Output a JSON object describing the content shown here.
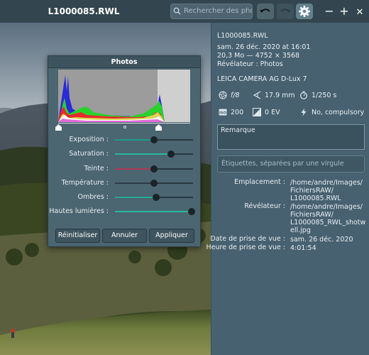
{
  "window": {
    "title": "L1000085.RWL",
    "search_placeholder": "Rechercher des pho…",
    "icons": [
      "search-icon",
      "rotate-left-icon",
      "rotate-right-icon",
      "gear-icon",
      "minimize-icon",
      "maximize-icon",
      "close-icon"
    ],
    "minimize_label": "−",
    "maximize_label": "+",
    "close_label": "✕"
  },
  "info": {
    "filename": "L1000085.RWL",
    "date": "sam. 26 déc. 2020 at 16:01",
    "size_dims": "20,3 Mo — 4752 × 3568",
    "developer": "Révélateur : Photos",
    "camera": "LEICA CAMERA AG D-Lux 7",
    "aperture": "f/8",
    "focal": "17.9 mm",
    "shutter": "1/250 s",
    "iso": "200",
    "ev": "0 EV",
    "flash": "No, compulsory",
    "remark_text": "Remarque",
    "tags_placeholder": "Étiquettes, séparées par une virgule",
    "details": {
      "location_label": "Emplacement :",
      "location_lines": [
        "/home/andre/Images/",
        "FichiersRAW/",
        "L1000085.RWL"
      ],
      "developer_label": "Révélateur :",
      "developer_lines": [
        "/home/andre/Images/",
        "FichiersRAW/",
        "L1000085_RWL_shotw",
        "ell.jpg"
      ],
      "date_label": "Date de prise de vue :",
      "date_value": "sam. 26 déc. 2020",
      "time_label": "Heure de prise de vue :",
      "time_value": "4:01:54"
    }
  },
  "dialog": {
    "title": "Photos",
    "sliders": [
      {
        "label": "Exposition :",
        "value": 0.5,
        "color": "#1f9c8a"
      },
      {
        "label": "Saturation :",
        "value": 0.72,
        "color": "#27b79c"
      },
      {
        "label": "Teinte :",
        "value": 0.5,
        "color": "#b03a58"
      },
      {
        "label": "Température :",
        "value": 0.5,
        "color": "#2a3c45"
      },
      {
        "label": "Ombres :",
        "value": 0.53,
        "color": "#24a994"
      },
      {
        "label": "Hautes lumières :",
        "value": 0.98,
        "color": "#27b89d"
      }
    ],
    "buttons": {
      "reset": "Réinitialiser",
      "cancel": "Annuler",
      "apply": "Appliquer"
    }
  }
}
